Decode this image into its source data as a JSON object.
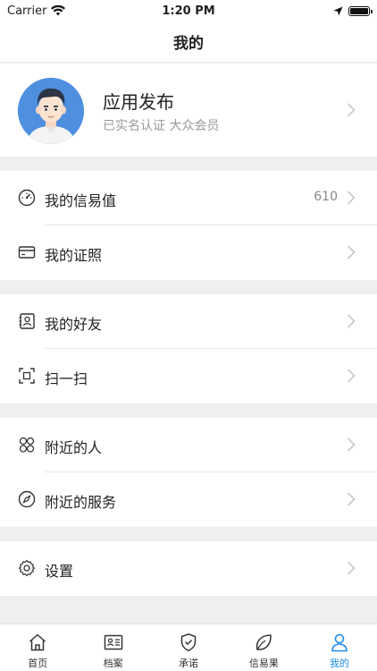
{
  "status_bar": {
    "carrier": "Carrier",
    "time": "1:20 PM",
    "battery_level": 1.0
  },
  "nav": {
    "title": "我的"
  },
  "profile": {
    "name": "应用发布",
    "subtitle": "已实名认证 大众会员"
  },
  "groups": [
    {
      "items": [
        {
          "label": "我的信易值",
          "value": "610",
          "icon": "speedometer-icon"
        },
        {
          "label": "我的证照",
          "icon": "card-icon"
        }
      ]
    },
    {
      "items": [
        {
          "label": "我的好友",
          "icon": "contacts-icon"
        },
        {
          "label": "扫一扫",
          "icon": "scan-icon"
        }
      ]
    },
    {
      "items": [
        {
          "label": "附近的人",
          "icon": "people-icon"
        },
        {
          "label": "附近的服务",
          "icon": "compass-icon"
        }
      ]
    },
    {
      "items": [
        {
          "label": "设置",
          "icon": "gear-icon"
        }
      ]
    }
  ],
  "tabs": [
    {
      "label": "首页",
      "icon": "home-icon",
      "active": false
    },
    {
      "label": "档案",
      "icon": "id-card-icon",
      "active": false
    },
    {
      "label": "承诺",
      "icon": "shield-check-icon",
      "active": false
    },
    {
      "label": "信易果",
      "icon": "leaf-icon",
      "active": false
    },
    {
      "label": "我的",
      "icon": "person-icon",
      "active": true
    }
  ],
  "colors": {
    "accent": "#1d8de8",
    "background": "#efefef",
    "avatar_bg": "#4f8fe0"
  }
}
